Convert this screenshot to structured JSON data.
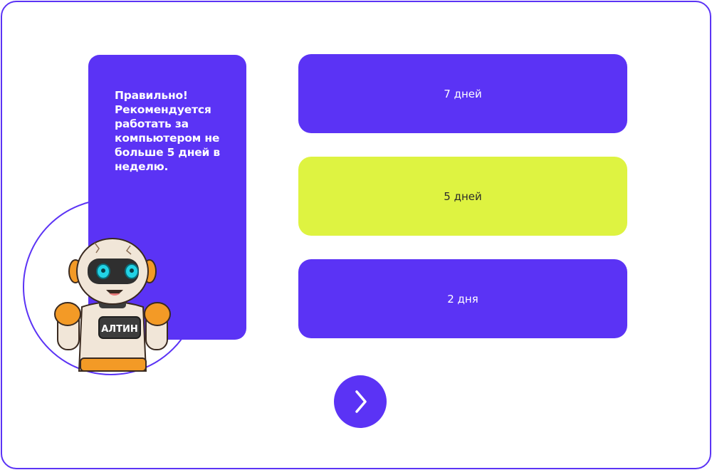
{
  "feedback": {
    "message": "Правильно! Рекомендуется работать за компьютером не больше 5 дней в неделю."
  },
  "mascot": {
    "badge_label": "АЛТИН",
    "icon": "robot-mascot"
  },
  "options": [
    {
      "label": "7 дней",
      "state": "default"
    },
    {
      "label": "5 дней",
      "state": "selected"
    },
    {
      "label": "2 дня",
      "state": "default"
    }
  ],
  "next_button": {
    "icon": "chevron-right-icon"
  },
  "colors": {
    "accent": "#5b33f5",
    "selected": "#def341",
    "text_on_accent": "#ffffff"
  }
}
